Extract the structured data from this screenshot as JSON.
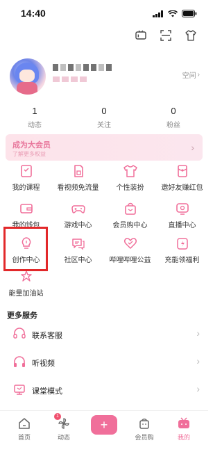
{
  "status_bar": {
    "time": "14:40"
  },
  "profile": {
    "space_label": "空间"
  },
  "stats": [
    {
      "value": "1",
      "label": "动态"
    },
    {
      "value": "0",
      "label": "关注"
    },
    {
      "value": "0",
      "label": "粉丝"
    }
  ],
  "vip": {
    "title": "成为大会员",
    "subtitle": "了解更多权益"
  },
  "grid": [
    {
      "label": "我的课程",
      "icon": "course-icon"
    },
    {
      "label": "看视频免流量",
      "icon": "sim-card-icon"
    },
    {
      "label": "个性装扮",
      "icon": "shirt-icon"
    },
    {
      "label": "邀好友赚红包",
      "icon": "red-packet-icon"
    },
    {
      "label": "我的钱包",
      "icon": "wallet-icon"
    },
    {
      "label": "游戏中心",
      "icon": "gamepad-icon"
    },
    {
      "label": "会员购中心",
      "icon": "shopping-bag-icon"
    },
    {
      "label": "直播中心",
      "icon": "live-icon"
    },
    {
      "label": "创作中心",
      "icon": "lightbulb-icon"
    },
    {
      "label": "社区中心",
      "icon": "chat-icon"
    },
    {
      "label": "哔哩哔哩公益",
      "icon": "heart-icon"
    },
    {
      "label": "充能领福利",
      "icon": "energy-icon"
    },
    {
      "label": "能量加油站",
      "icon": "energy-station-icon"
    }
  ],
  "more_services": {
    "title": "更多服务",
    "items": [
      {
        "label": "联系客服",
        "icon": "headset-icon"
      },
      {
        "label": "听视频",
        "icon": "headphones-icon"
      },
      {
        "label": "课堂模式",
        "icon": "classroom-icon"
      }
    ]
  },
  "bottom_nav": [
    {
      "label": "首页",
      "icon": "home-icon"
    },
    {
      "label": "动态",
      "icon": "pinwheel-icon",
      "badge": "1"
    },
    {
      "label": "",
      "icon": "plus-icon"
    },
    {
      "label": "会员购",
      "icon": "shopping-bag-icon"
    },
    {
      "label": "我的",
      "icon": "tv-icon",
      "active": true
    }
  ],
  "colors": {
    "accent": "#f06f9a",
    "highlight": "#e2282a"
  }
}
